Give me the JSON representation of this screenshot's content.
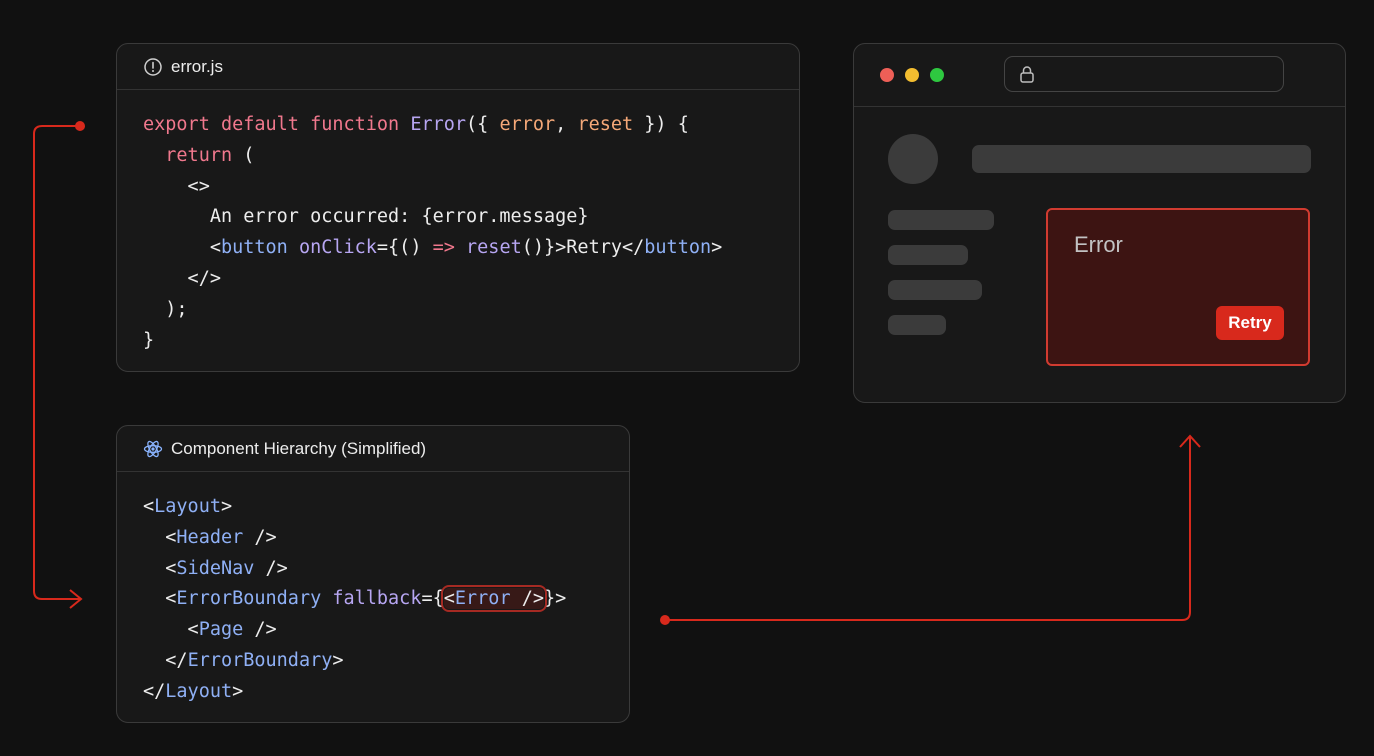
{
  "error_panel": {
    "title": "error.js",
    "code": {
      "l1_kw": "export default function",
      "l1_fn": "Error",
      "l1_p1": "error",
      "l1_p2": "reset",
      "l2_kw": "return",
      "l4_text": "An error occurred: {error.message}",
      "l5_tag": "button",
      "l5_attr": "onClick",
      "l5_arrow": "=>",
      "l5_call": "reset",
      "l5_text": "Retry"
    }
  },
  "hierarchy_panel": {
    "title": "Component Hierarchy (Simplified)",
    "code": {
      "layout": "Layout",
      "header": "Header",
      "sidenav": "SideNav",
      "boundary": "ErrorBoundary",
      "fallback_attr": "fallback",
      "fallback_component": "Error",
      "page": "Page"
    }
  },
  "browser": {
    "traffic_lights": [
      "#ee5f57",
      "#f3bd30",
      "#2ec840"
    ],
    "url_icon": "lock-icon",
    "error_card": {
      "title": "Error",
      "retry_label": "Retry"
    }
  },
  "colors": {
    "accent": "#d8291c",
    "connector": "#d8291c"
  }
}
